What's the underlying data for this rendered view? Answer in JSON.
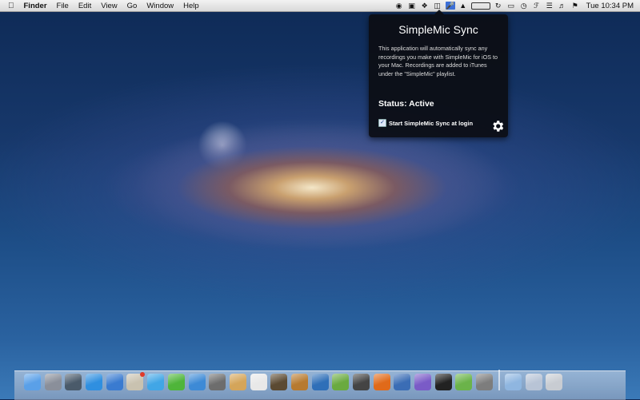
{
  "menubar": {
    "app_name": "Finder",
    "menus": [
      "File",
      "Edit",
      "View",
      "Go",
      "Window",
      "Help"
    ],
    "status_icons": [
      "app-icon-1",
      "app-icon-2",
      "dropbox-icon",
      "app-icon-4",
      "simplemic-icon",
      "app-icon-6",
      "battery-meter-icon",
      "time-machine-icon",
      "display-icon",
      "clock-icon",
      "bluetooth-icon",
      "wifi-icon",
      "volume-icon",
      "flag-icon"
    ],
    "clock": "Tue 10:34 PM"
  },
  "popover": {
    "title": "SimpleMic Sync",
    "description": "This application will automatically sync any recordings you make with SimpleMic for iOS to your Mac. Recordings are added to iTunes under the \"SimpleMic\" playlist.",
    "status": "Status: Active",
    "checkbox_label": "Start SimpleMic Sync at login",
    "checkbox_checked": true
  },
  "dock": {
    "apps": [
      {
        "name": "finder-icon",
        "color": "#5aa0e8"
      },
      {
        "name": "launchpad-icon",
        "color": "#8a8f9a"
      },
      {
        "name": "mission-control-icon",
        "color": "#4a5a6a"
      },
      {
        "name": "app-store-icon",
        "color": "#2f8fe0"
      },
      {
        "name": "itunes-icon",
        "color": "#3a7bd0"
      },
      {
        "name": "preview-icon",
        "color": "#c9c2b0"
      },
      {
        "name": "twitter-icon",
        "color": "#41a6e6"
      },
      {
        "name": "adium-icon",
        "color": "#4fb53a"
      },
      {
        "name": "safari-icon",
        "color": "#3d8ad6"
      },
      {
        "name": "screenshot-icon",
        "color": "#6d6d6d"
      },
      {
        "name": "archive-icon",
        "color": "#d4a55a"
      },
      {
        "name": "calendar-icon",
        "color": "#e8e8e8"
      },
      {
        "name": "photo-icon",
        "color": "#5b4a32"
      },
      {
        "name": "garageband-icon",
        "color": "#b77a30"
      },
      {
        "name": "xray-icon",
        "color": "#2f6fb8"
      },
      {
        "name": "numbers-icon",
        "color": "#6aaa40"
      },
      {
        "name": "slideshow-icon",
        "color": "#444"
      },
      {
        "name": "ws-icon",
        "color": "#e06a1a"
      },
      {
        "name": "xcode-icon",
        "color": "#3b6db5"
      },
      {
        "name": "monster-icon",
        "color": "#7a5bc7"
      },
      {
        "name": "terminal-icon",
        "color": "#222"
      },
      {
        "name": "evernote-icon",
        "color": "#6bb34a"
      },
      {
        "name": "system-prefs-icon",
        "color": "#7d7d7d"
      },
      {
        "name": "folder-icon",
        "color": "#8fb6e0"
      },
      {
        "name": "downloads-icon",
        "color": "#b8c4d6"
      },
      {
        "name": "trash-icon",
        "color": "#c8ccd2"
      }
    ]
  }
}
